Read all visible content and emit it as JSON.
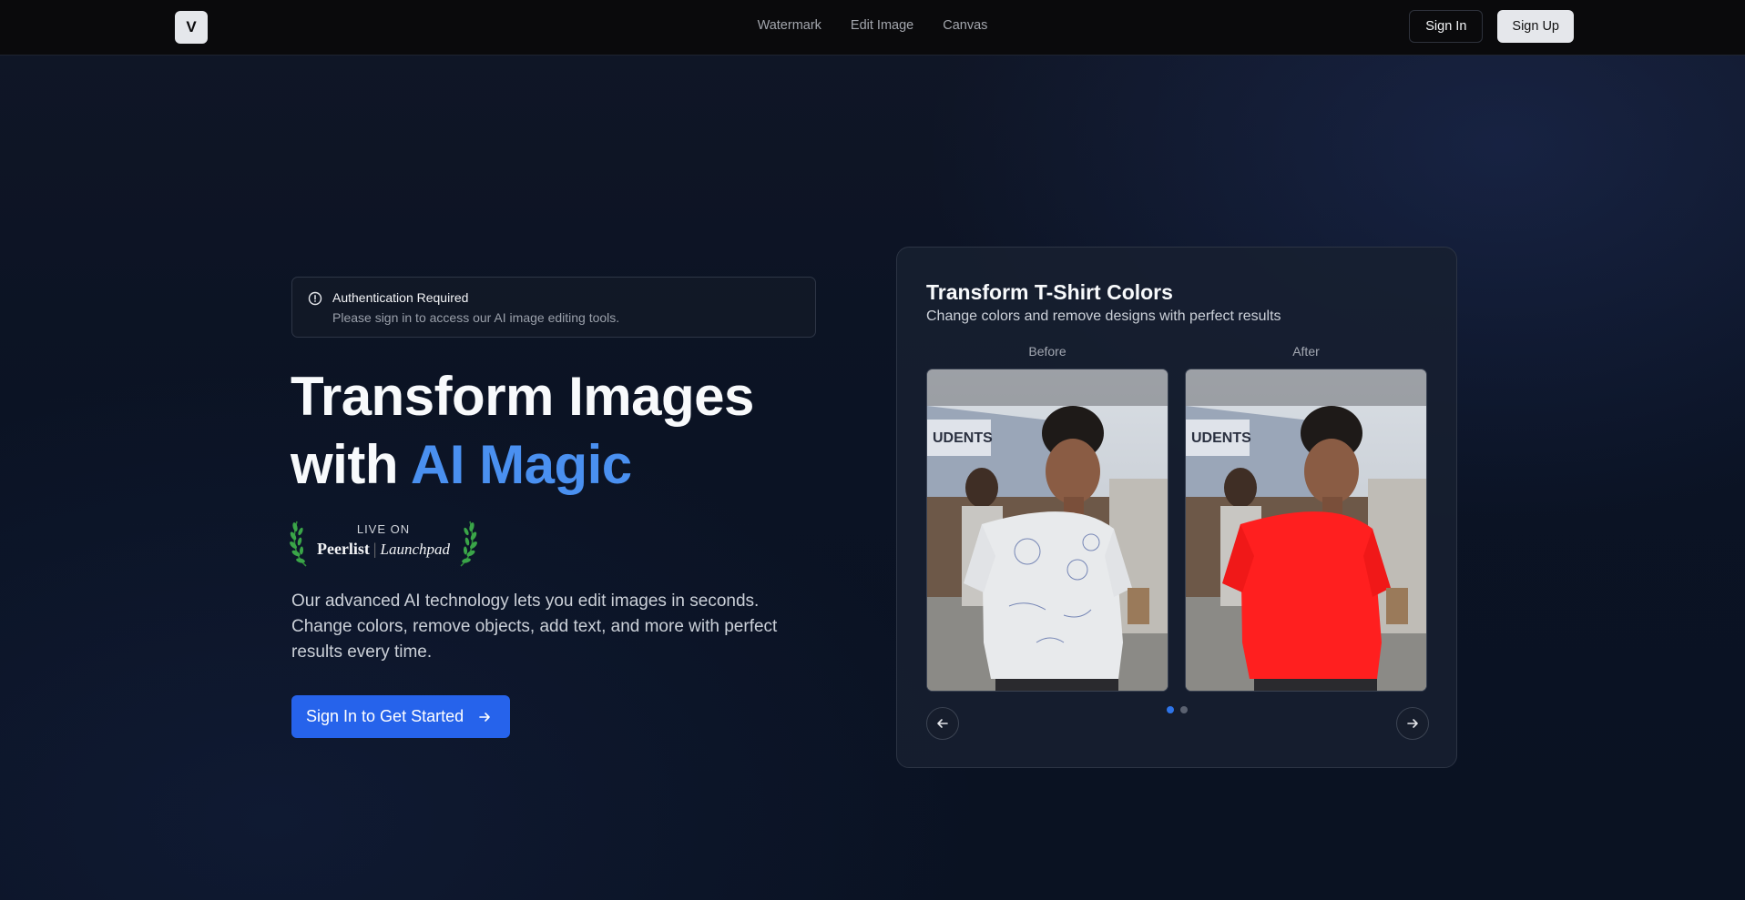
{
  "header": {
    "logo_letter": "V",
    "nav": [
      "Watermark",
      "Edit Image",
      "Canvas"
    ],
    "sign_in": "Sign In",
    "sign_up": "Sign Up"
  },
  "alert": {
    "icon": "alert-circle-icon",
    "title": "Authentication Required",
    "description": "Please sign in to access our AI image editing tools."
  },
  "hero": {
    "title_line1": "Transform Images",
    "title_line2_prefix": "with ",
    "title_accent": "AI Magic",
    "badge_live": "LIVE ON",
    "badge_brand": "Peerlist",
    "badge_product": "Launchpad",
    "description": "Our advanced AI technology lets you edit images in seconds. Change colors, remove objects, add text, and more with perfect results every time.",
    "cta": "Sign In to Get Started"
  },
  "showcase": {
    "title": "Transform T-Shirt Colors",
    "subtitle": "Change colors and remove designs with perfect results",
    "before_label": "Before",
    "after_label": "After",
    "slide_count": 2,
    "active_slide": 0
  },
  "colors": {
    "accent": "#4a90f0",
    "cta": "#2663eb",
    "shirt_before": "#e8eaec",
    "shirt_after": "#ff1f1f"
  }
}
